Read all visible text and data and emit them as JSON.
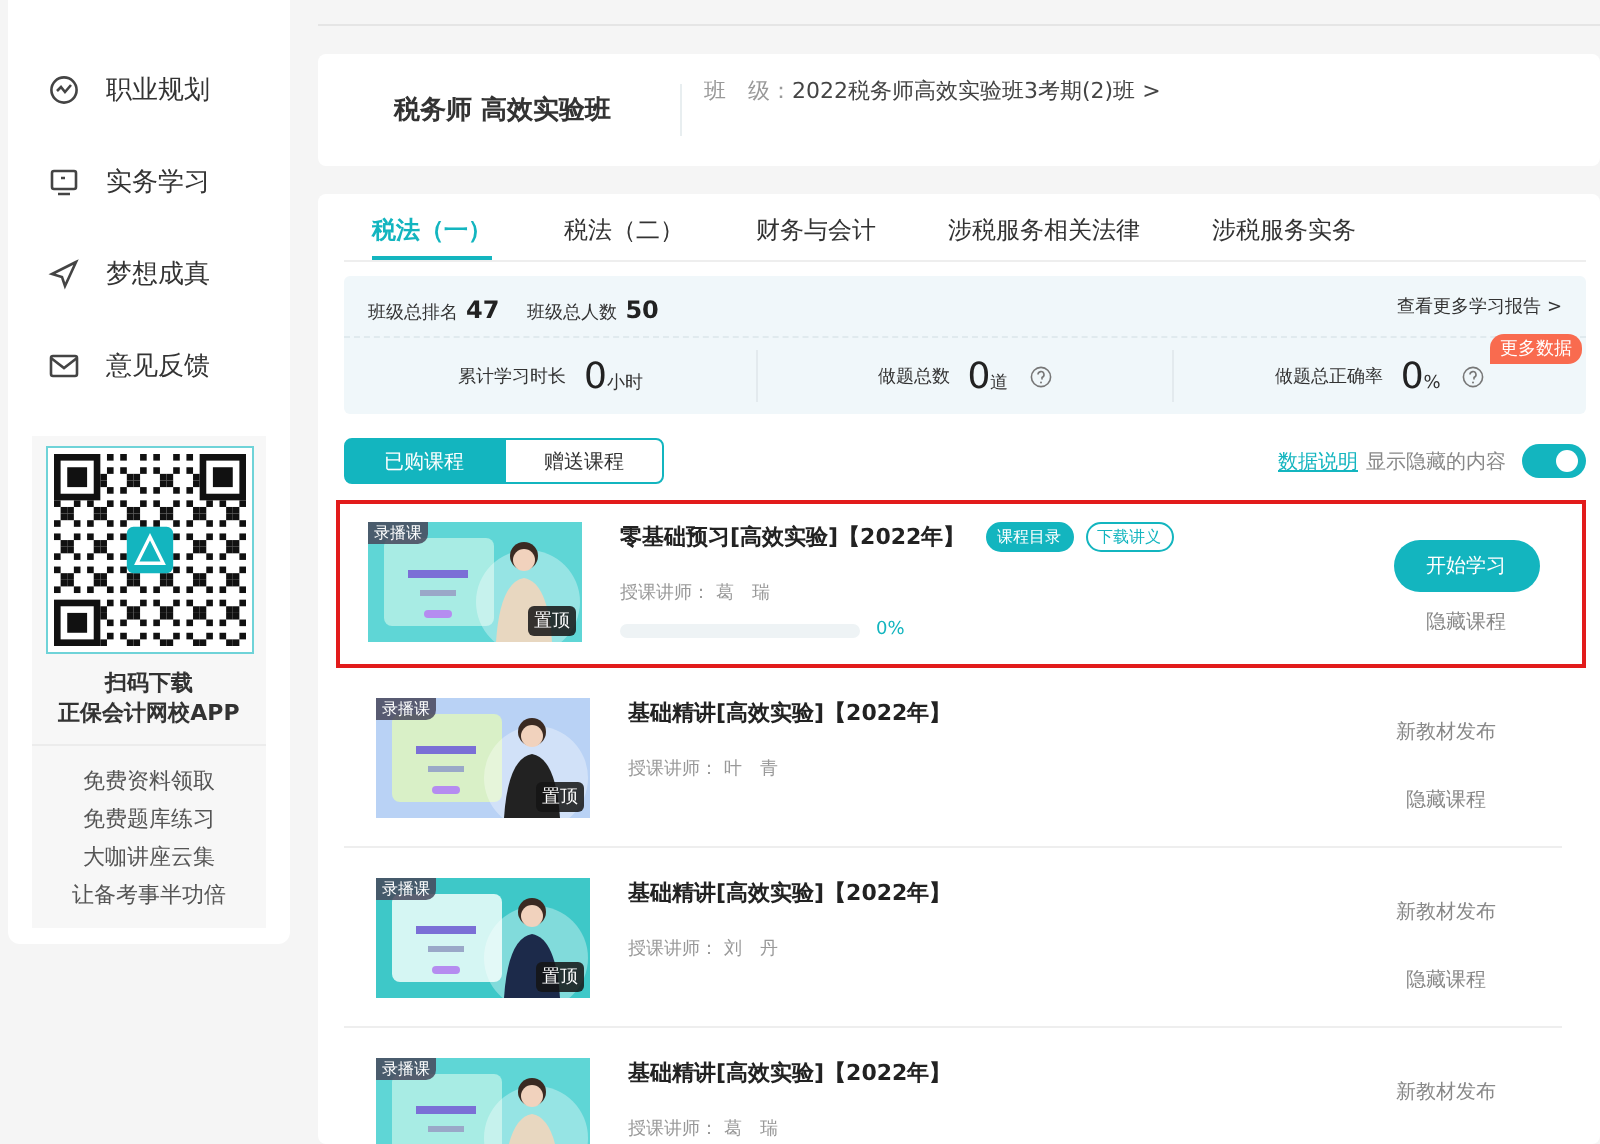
{
  "sidebar": {
    "items": [
      {
        "label": "职业规划",
        "kind": "career"
      },
      {
        "label": "实务学习",
        "kind": "practice"
      },
      {
        "label": "梦想成真",
        "kind": "dream"
      },
      {
        "label": "意见反馈",
        "kind": "feedback"
      }
    ],
    "app_promo": {
      "lines": [
        "扫码下载",
        "正保会计网校APP"
      ]
    },
    "links": [
      "免费资料领取",
      "免费题库练习",
      "大咖讲座云集",
      "让备考事半功倍"
    ]
  },
  "class_card": {
    "title": "税务师 高效实验班",
    "class_label": "班　级：",
    "class_name": "2022税务师高效实验班3考期(2)班",
    "chevron": ">"
  },
  "subject_tabs": [
    {
      "label": "税法（一）",
      "selected": true
    },
    {
      "label": "税法（二）",
      "selected": false
    },
    {
      "label": "财务与会计",
      "selected": false
    },
    {
      "label": "涉税服务相关法律",
      "selected": false
    },
    {
      "label": "涉税服务实务",
      "selected": false
    }
  ],
  "stats": {
    "rank_label": "班级总排名",
    "rank": "47",
    "total_label": "班级总人数",
    "total": "50",
    "report_link": "查看更多学习报告 >",
    "metrics": [
      {
        "label": "累计学习时长",
        "value": "0",
        "unit": "小时",
        "help": false
      },
      {
        "label": "做题总数",
        "value": "0",
        "unit": "道",
        "help": true
      },
      {
        "label": "做题总正确率",
        "value": "0",
        "unit": "%",
        "help": true,
        "badge": "更多数据"
      }
    ]
  },
  "course_tabs": [
    {
      "label": "已购课程",
      "selected": true
    },
    {
      "label": "赠送课程",
      "selected": false
    }
  ],
  "data_note_link": "数据说明",
  "show_hidden": {
    "label": "显示隐藏的内容",
    "on": true
  },
  "courses": [
    {
      "kind": "progress",
      "highlighted": true,
      "tag": "录播课",
      "pin": "置顶",
      "title": "零基础预习[高效实验]【2022年】",
      "buttons": [
        "课程目录",
        "下载讲义"
      ],
      "teacher_label": "授课讲师：",
      "teacher": "葛　瑞",
      "level": 0,
      "progress_text": "0%",
      "action": "开始学习",
      "hide": "隐藏课程"
    },
    {
      "kind": "notice",
      "highlighted": false,
      "tag": "录播课",
      "pin": "置顶",
      "title": "基础精讲[高效实验]【2022年】",
      "teacher_label": "授课讲师：",
      "teacher": "叶　青",
      "notice": "新教材发布",
      "hide": "隐藏课程"
    },
    {
      "kind": "notice",
      "highlighted": false,
      "tag": "录播课",
      "pin": "置顶",
      "title": "基础精讲[高效实验]【2022年】",
      "teacher_label": "授课讲师：",
      "teacher": "刘　丹",
      "notice": "新教材发布",
      "hide": "隐藏课程"
    },
    {
      "kind": "notice",
      "highlighted": false,
      "tag": "录播课",
      "title": "基础精讲[高效实验]【2022年】",
      "teacher_label": "授课讲师：",
      "teacher": "葛　瑞",
      "notice": "新教材发布"
    }
  ]
}
